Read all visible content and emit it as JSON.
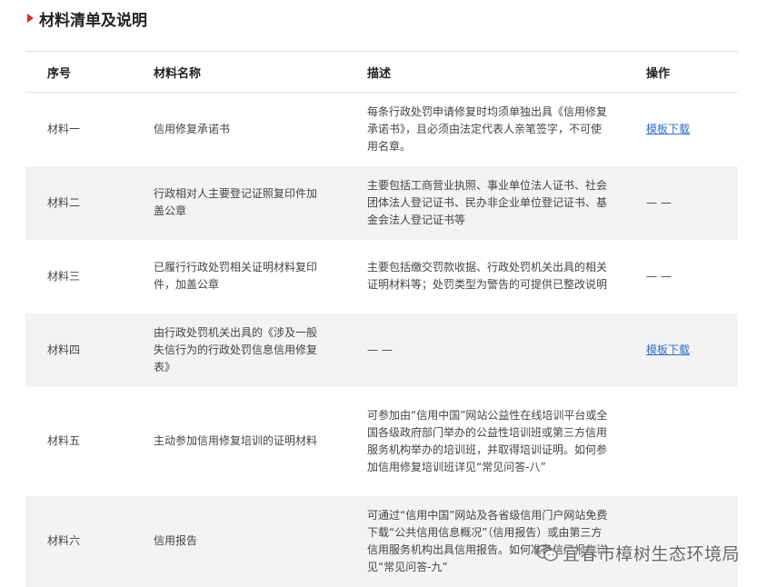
{
  "section": {
    "title": "材料清单及说明"
  },
  "table": {
    "headers": [
      "序号",
      "材料名称",
      "描述",
      "操作"
    ],
    "rows": [
      {
        "index": "材料一",
        "name": "信用修复承诺书",
        "desc": "每条行政处罚申请修复时均须单独出具《信用修复承诺书》，且必须由法定代表人亲笔签字，不可使用名章。",
        "action": "模板下载",
        "action_type": "link"
      },
      {
        "index": "材料二",
        "name": "行政相对人主要登记证照复印件加盖公章",
        "desc": "主要包括工商营业执照、事业单位法人证书、社会团体法人登记证书、民办非企业单位登记证书、基金会法人登记证书等",
        "action": "— —",
        "action_type": "dash"
      },
      {
        "index": "材料三",
        "name": "已履行行政处罚相关证明材料复印件，加盖公章",
        "desc": "主要包括缴交罚款收据、行政处罚机关出具的相关证明材料等；处罚类型为警告的可提供已整改说明",
        "action": "— —",
        "action_type": "dash"
      },
      {
        "index": "材料四",
        "name": "由行政处罚机关出具的《涉及一般失信行为的行政处罚信息信用修复表》",
        "desc": "— —",
        "action": "模板下载",
        "action_type": "link"
      },
      {
        "index": "材料五",
        "name": "主动参加信用修复培训的证明材料",
        "desc": "可参加由“信用中国”网站公益性在线培训平台或全国各级政府部门举办的公益性培训班或第三方信用服务机构举办的培训班，并取得培训证明。如何参加信用修复培训班详见“常见问答-八”",
        "action": "",
        "action_type": "none"
      },
      {
        "index": "材料六",
        "name": "信用报告",
        "desc": "可通过“信用中国”网站及各省级信用门户网站免费下载“公共信用信息概况”（信用报告）或由第三方信用服务机构出具信用报告。如何准备信用报告详见“常见问答-九”",
        "action": "",
        "action_type": "none"
      }
    ]
  },
  "watermark": {
    "text": "宜春市樟树生态环境局",
    "icon": "wechat-icon"
  },
  "colors": {
    "accent": "#d9322b",
    "link": "#2f6fc9",
    "stripe": "#f3f3f3"
  }
}
